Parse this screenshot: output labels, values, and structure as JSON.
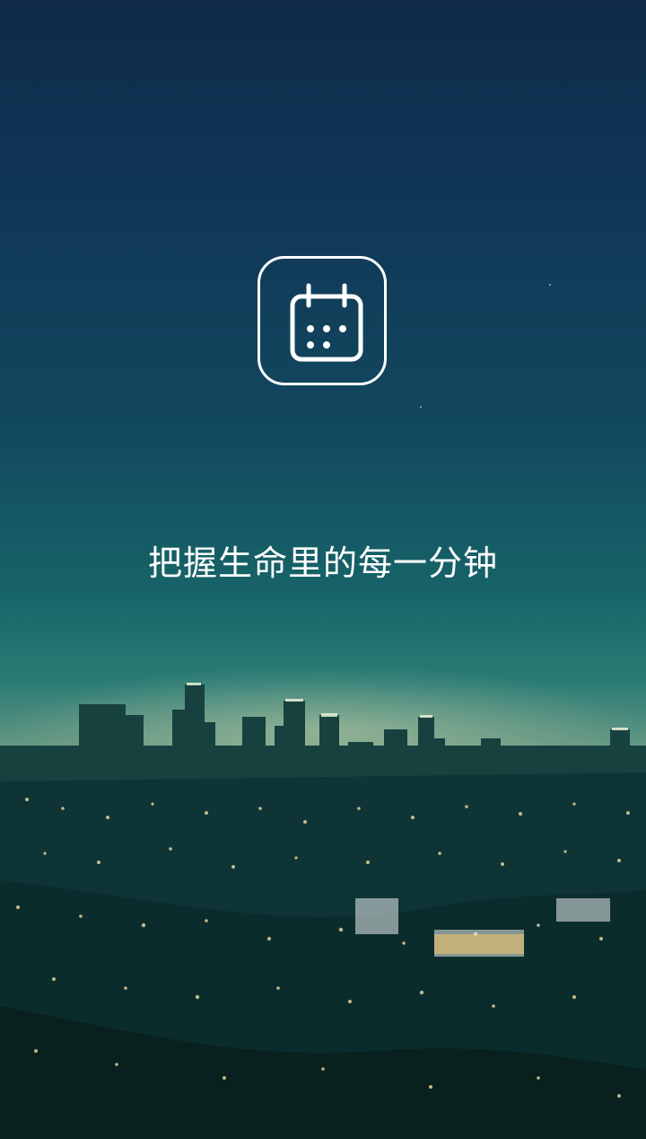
{
  "app": {
    "icon": "calendar-icon",
    "slogan": "把握生命里的每一分钟"
  },
  "colors": {
    "sky_top": "#0f2a4a",
    "sky_mid": "#176468",
    "horizon_glow": "#a4b491",
    "city_base": "#0c3a3e",
    "foreground": "#ffffff"
  }
}
